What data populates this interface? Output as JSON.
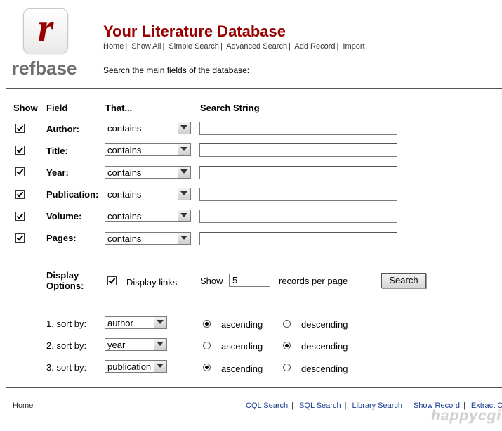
{
  "header": {
    "logo_letter": "r",
    "logo_word": "refbase",
    "title": "Your Literature Database",
    "nav": [
      "Home",
      "Show All",
      "Simple Search",
      "Advanced Search",
      "Add Record",
      "Import"
    ],
    "subtitle": "Search the main fields of the database:"
  },
  "columns": {
    "show": "Show",
    "field": "Field",
    "that": "That...",
    "search": "Search String"
  },
  "rows": [
    {
      "label": "Author:",
      "operator": "contains",
      "checked": true,
      "value": ""
    },
    {
      "label": "Title:",
      "operator": "contains",
      "checked": true,
      "value": ""
    },
    {
      "label": "Year:",
      "operator": "contains",
      "checked": true,
      "value": ""
    },
    {
      "label": "Publication:",
      "operator": "contains",
      "checked": true,
      "value": ""
    },
    {
      "label": "Volume:",
      "operator": "contains",
      "checked": true,
      "value": ""
    },
    {
      "label": "Pages:",
      "operator": "contains",
      "checked": true,
      "value": ""
    }
  ],
  "display": {
    "label_line1": "Display",
    "label_line2": "Options:",
    "links_label": "Display links",
    "links_checked": true,
    "show_label": "Show",
    "records_value": "5",
    "per_page_label": "records per page",
    "search_button": "Search"
  },
  "sort": [
    {
      "label": "1. sort by:",
      "value": "author",
      "order": "ascending"
    },
    {
      "label": "2. sort by:",
      "value": "year",
      "order": "descending"
    },
    {
      "label": "3. sort by:",
      "value": "publication",
      "order": "ascending"
    }
  ],
  "sort_options": {
    "asc": "ascending",
    "desc": "descending"
  },
  "footer": {
    "home": "Home",
    "links": [
      "CQL Search",
      "SQL Search",
      "Library Search",
      "Show Record",
      "Extract C"
    ]
  },
  "watermark": "happycgi"
}
